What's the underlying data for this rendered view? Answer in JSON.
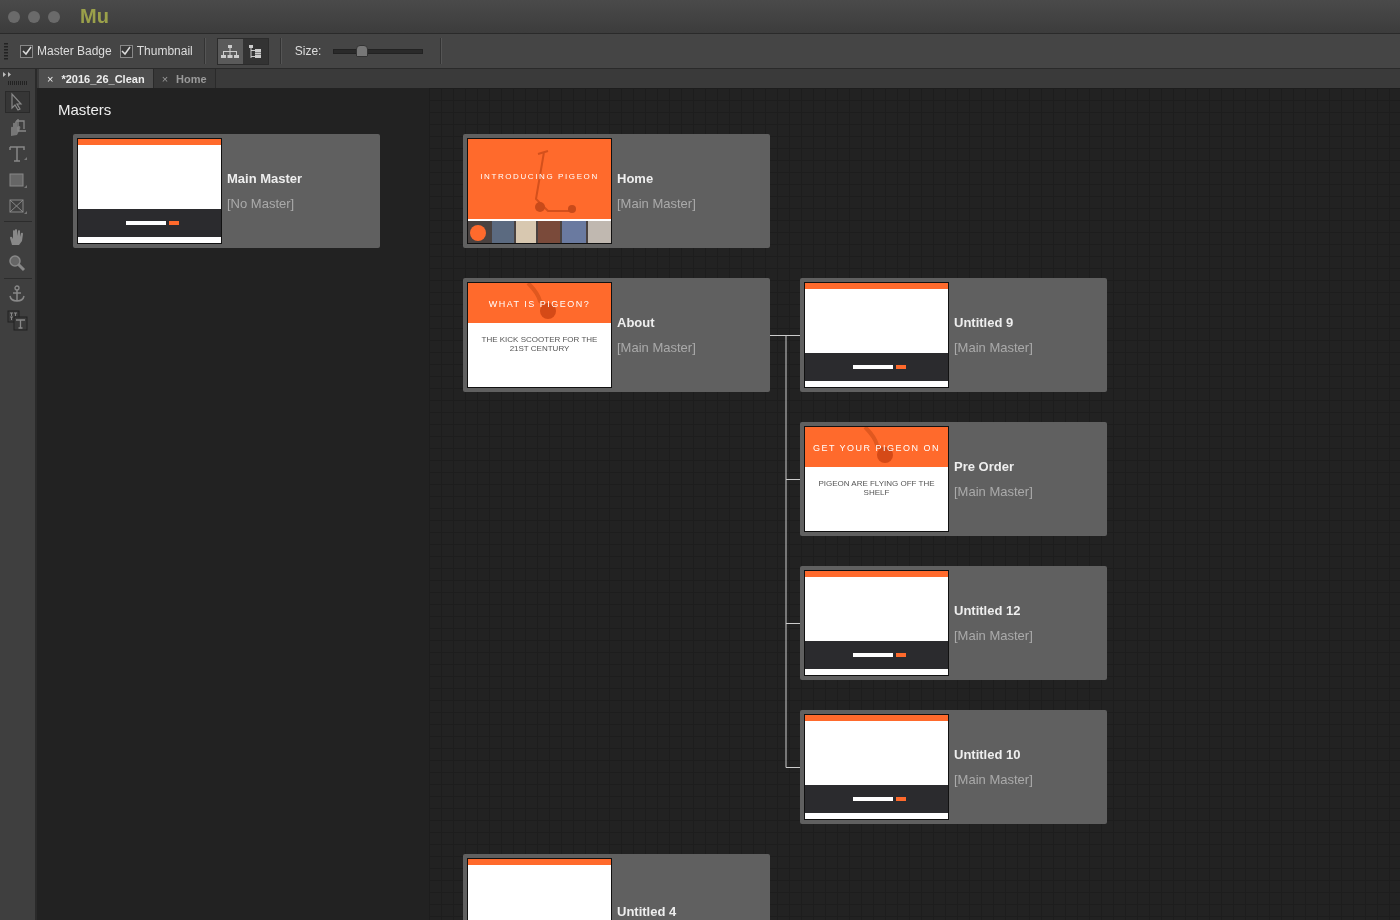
{
  "app": {
    "logo": "Mu"
  },
  "toolbar": {
    "checkboxes": [
      {
        "label": "Master Badge",
        "checked": true
      },
      {
        "label": "Thumbnail",
        "checked": true
      }
    ],
    "view_buttons": [
      {
        "kind": "tree",
        "selected": true
      },
      {
        "kind": "list",
        "selected": false
      }
    ],
    "size": {
      "label": "Size:",
      "level": 0.3
    }
  },
  "tabs": [
    {
      "label": "*2016_26_Clean",
      "close": "×",
      "selected": true
    },
    {
      "label": "Home",
      "close": "×",
      "selected": false
    }
  ],
  "tools": [
    {
      "kind": "select",
      "selected": true
    },
    {
      "kind": "crop",
      "selected": false
    },
    {
      "kind": "text",
      "selected": false
    },
    {
      "kind": "rect",
      "selected": false
    },
    {
      "kind": "frame",
      "selected": false
    },
    {
      "kind": "hand",
      "selected": false
    },
    {
      "kind": "zoom",
      "selected": false
    },
    {
      "kind": "anchor",
      "selected": false
    },
    {
      "kind": "textframes",
      "selected": false
    }
  ],
  "masters": {
    "heading": "Masters",
    "items": [
      {
        "name": "Main Master",
        "master": "[No Master]",
        "thumbnail": {
          "kind": "blank"
        }
      }
    ]
  },
  "pages": [
    {
      "name": "Home",
      "master": "[Main Master]",
      "thumbnail": {
        "kind": "hero",
        "headline": "INTRODUCING PIGEON"
      }
    },
    {
      "name": "About",
      "master": "[Main Master]",
      "thumbnail": {
        "kind": "split",
        "headline": "WHAT IS PIGEON?",
        "subheading": "THE KICK SCOOTER FOR THE 21ST CENTURY"
      },
      "children": [
        {
          "name": "Untitled 9",
          "master": "[Main Master]",
          "thumbnail": {
            "kind": "blank"
          }
        },
        {
          "name": "Pre Order",
          "master": "[Main Master]",
          "thumbnail": {
            "kind": "split",
            "headline": "GET YOUR PIGEON ON",
            "subheading": "PIGEON ARE FLYING OFF THE SHELF"
          }
        },
        {
          "name": "Untitled 12",
          "master": "[Main Master]",
          "thumbnail": {
            "kind": "blank"
          }
        },
        {
          "name": "Untitled 10",
          "master": "[Main Master]",
          "thumbnail": {
            "kind": "blank"
          }
        }
      ]
    },
    {
      "name": "Untitled 4",
      "thumbnail": {
        "kind": "blank"
      }
    }
  ]
}
